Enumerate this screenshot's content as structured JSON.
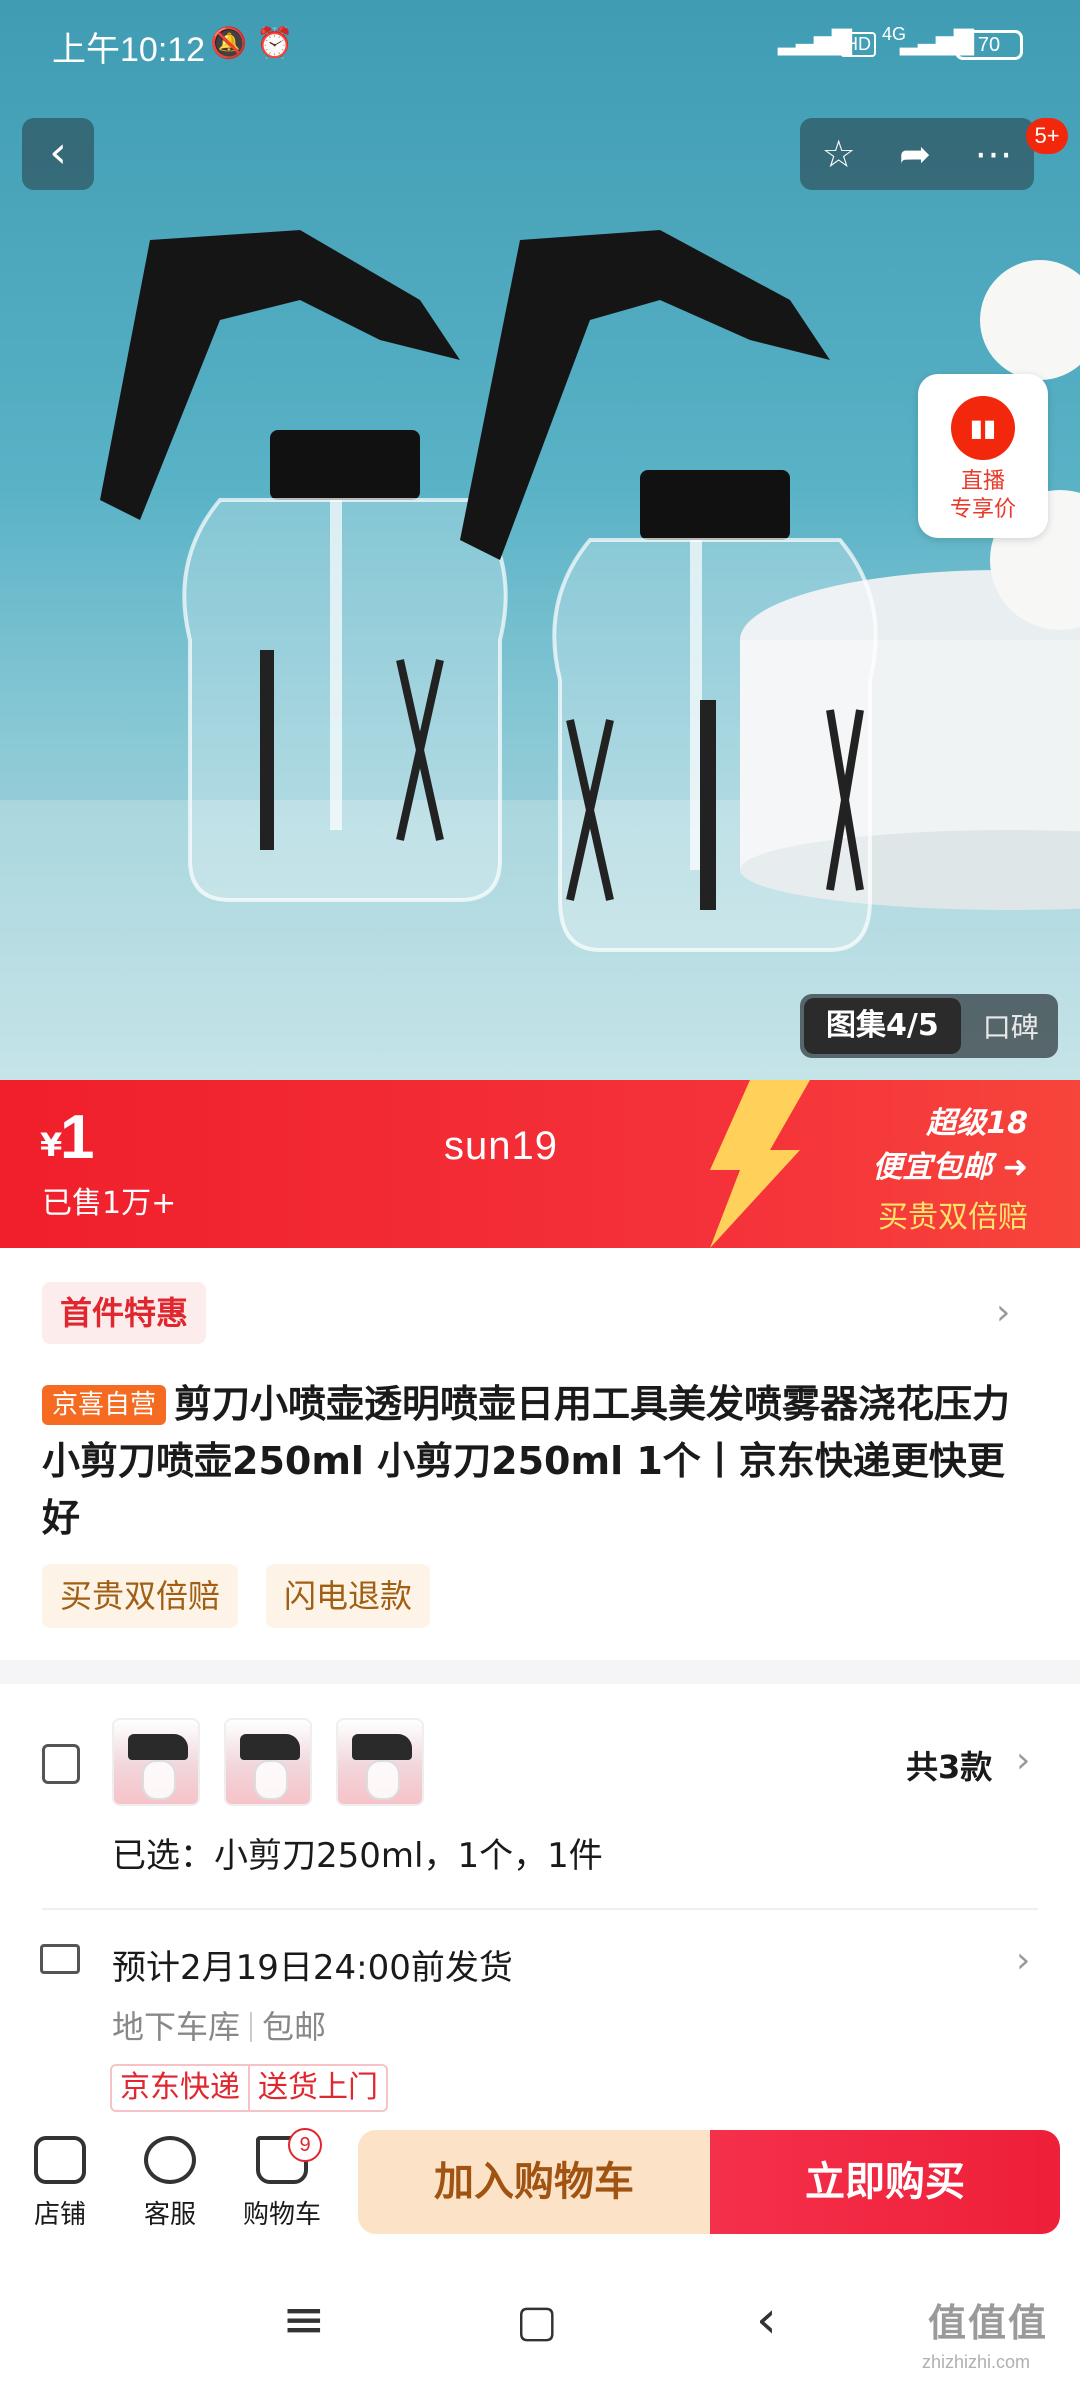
{
  "status_bar": {
    "time": "上午10:12",
    "signal_hd": "HD",
    "network": "4G",
    "battery": "70"
  },
  "header": {
    "more_badge": "5+"
  },
  "live": {
    "line1": "直播",
    "line2": "专享价"
  },
  "gallery": {
    "indicator": "图集4/5",
    "review_tab": "口碑"
  },
  "price_banner": {
    "currency": "¥",
    "price": "1",
    "sold": "已售1万+",
    "center_text": "sun19",
    "promo_line1": "超级18",
    "promo_line2": "便宜包邮",
    "promo_line3": "买贵双倍赔"
  },
  "offer": {
    "first_item_badge": "首件特惠"
  },
  "product": {
    "self_op_tag": "京喜自营",
    "title": "剪刀小喷壶透明喷壶日用工具美发喷雾器浇花压力小剪刀喷壶250ml 小剪刀250ml 1个丨京东快递更快更好",
    "service_tags": [
      "买贵双倍赔",
      "闪电退款"
    ]
  },
  "selection": {
    "variant_count": "共3款",
    "selected": "已选：小剪刀250ml，1个，1件"
  },
  "shipping": {
    "estimate": "预计2月19日24:00前发货",
    "warehouse": "地下车库",
    "free_shipping": "包邮",
    "tags": [
      "京东快递",
      "送货上门"
    ]
  },
  "bottom_bar": {
    "store": "店铺",
    "service": "客服",
    "cart": "购物车",
    "cart_count": "9",
    "add_to_cart": "加入购物车",
    "buy_now": "立即购买"
  },
  "watermark": {
    "main": "值值值",
    "sub": "zhizhizhi.com"
  }
}
